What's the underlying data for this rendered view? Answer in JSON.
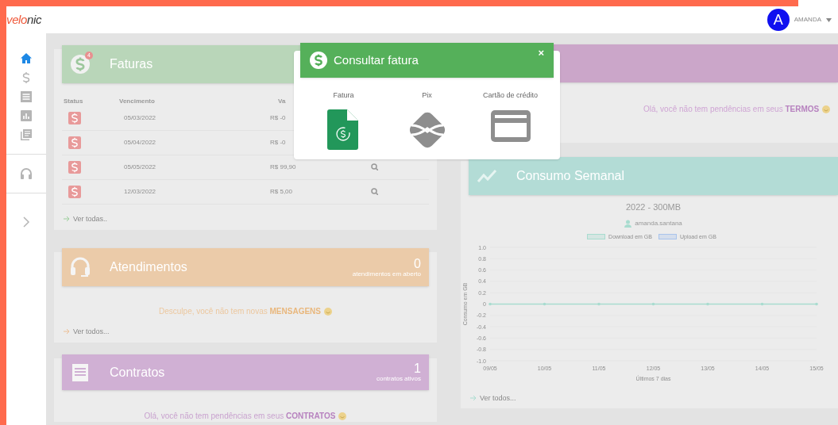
{
  "logo": {
    "accent": "velo",
    "rest": "nic"
  },
  "user": {
    "initial": "A",
    "name": "AMANDA"
  },
  "sidebar": {
    "items": [
      {
        "kind": "home",
        "selected": true
      },
      {
        "kind": "dollar",
        "selected": false
      },
      {
        "kind": "list",
        "selected": false
      },
      {
        "kind": "chart",
        "selected": false
      },
      {
        "kind": "library",
        "selected": false
      },
      {
        "kind": "headset",
        "selected": false
      },
      {
        "kind": "chevron",
        "selected": false
      }
    ]
  },
  "faturas": {
    "title": "Faturas",
    "badge": "4",
    "columns": [
      "Status",
      "Vencimento",
      "Va"
    ],
    "rows": [
      {
        "due": "05/03/2022",
        "value": "R$ -0",
        "search_icon": false
      },
      {
        "due": "05/04/2022",
        "value": "R$ -0",
        "search_icon": false
      },
      {
        "due": "05/05/2022",
        "value": "R$ 99,90",
        "search_icon": true
      },
      {
        "due": "12/03/2022",
        "value": "R$ 5,00",
        "search_icon": true
      }
    ],
    "link": "Ver todas.."
  },
  "atendimentos": {
    "title": "Atendimentos",
    "count": "0",
    "count_label": "atendimentos em aberto",
    "message": "Desculpe, você não tem novas **MENSAGENS**",
    "link": "Ver todos..."
  },
  "contratos": {
    "title": "Contratos",
    "count": "1",
    "count_label": "contratos ativos",
    "message": "Olá, você não tem pendências em seus **CONTRATOS**"
  },
  "termos": {
    "message": "Olá, você não tem pendências em seus **TERMOS**"
  },
  "consumo": {
    "title": "Consumo Semanal",
    "subtitle": "2022 - 300MB",
    "user": "amanda.santana",
    "link": "Ver todos...",
    "chart_data": {
      "type": "line",
      "xlabel": "Últimos 7 dias",
      "ylabel": "Consumo em GB",
      "categories": [
        "09/05",
        "10/05",
        "11/05",
        "12/05",
        "13/05",
        "14/05",
        "15/05"
      ],
      "series": [
        {
          "name": "Download em GB",
          "color": "#a8dccf",
          "values": [
            0,
            0,
            0,
            0,
            0,
            0,
            0
          ]
        },
        {
          "name": "Upload em GB",
          "color": "#a9c4ec",
          "values": [
            null,
            null,
            null,
            null,
            null,
            null,
            null
          ]
        }
      ],
      "ylim": [
        -1,
        1
      ],
      "yticks": [
        {
          "value": 1,
          "label": "1.0"
        },
        {
          "value": 0.8,
          "label": "0.8"
        },
        {
          "value": 0.6,
          "label": "0.6"
        },
        {
          "value": 0.4,
          "label": "0.4"
        },
        {
          "value": 0.2,
          "label": "0.2"
        },
        {
          "value": 0,
          "label": "0"
        },
        {
          "value": -0.2,
          "label": "-0.2"
        },
        {
          "value": -0.4,
          "label": "-0.4"
        },
        {
          "value": -0.6,
          "label": "-0.6"
        },
        {
          "value": -0.8,
          "label": "-0.8"
        },
        {
          "value": -1,
          "label": "-1.0"
        }
      ]
    }
  },
  "modal": {
    "title": "Consultar fatura",
    "close": "×",
    "options": [
      {
        "kind": "invoice",
        "label": "Fatura"
      },
      {
        "kind": "pix",
        "label": "Pix"
      },
      {
        "kind": "card",
        "label": "Cartão de crédito"
      }
    ]
  }
}
